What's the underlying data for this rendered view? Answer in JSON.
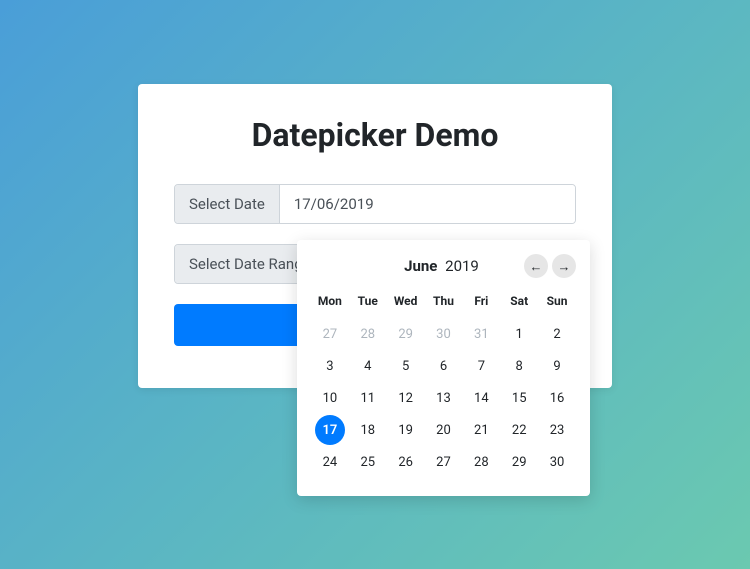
{
  "title": "Datepicker Demo",
  "input1": {
    "label": "Select Date",
    "value": "17/06/2019"
  },
  "input2": {
    "label": "Select Date Range",
    "value": ""
  },
  "datepicker": {
    "month": "June",
    "year": "2019",
    "prev": "←",
    "next": "→",
    "weekdays": [
      "Mon",
      "Tue",
      "Wed",
      "Thu",
      "Fri",
      "Sat",
      "Sun"
    ],
    "days": [
      {
        "n": 27,
        "muted": true
      },
      {
        "n": 28,
        "muted": true
      },
      {
        "n": 29,
        "muted": true
      },
      {
        "n": 30,
        "muted": true
      },
      {
        "n": 31,
        "muted": true
      },
      {
        "n": 1
      },
      {
        "n": 2
      },
      {
        "n": 3
      },
      {
        "n": 4
      },
      {
        "n": 5
      },
      {
        "n": 6
      },
      {
        "n": 7
      },
      {
        "n": 8
      },
      {
        "n": 9
      },
      {
        "n": 10
      },
      {
        "n": 11
      },
      {
        "n": 12
      },
      {
        "n": 13
      },
      {
        "n": 14
      },
      {
        "n": 15
      },
      {
        "n": 16
      },
      {
        "n": 17,
        "selected": true
      },
      {
        "n": 18
      },
      {
        "n": 19
      },
      {
        "n": 20
      },
      {
        "n": 21
      },
      {
        "n": 22
      },
      {
        "n": 23
      },
      {
        "n": 24
      },
      {
        "n": 25
      },
      {
        "n": 26
      },
      {
        "n": 27
      },
      {
        "n": 28
      },
      {
        "n": 29
      },
      {
        "n": 30
      }
    ]
  }
}
